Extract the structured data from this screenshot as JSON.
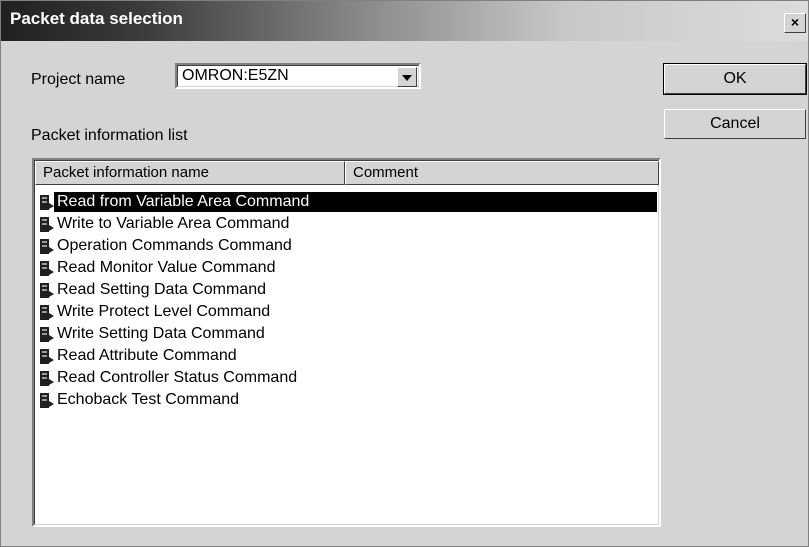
{
  "window": {
    "title": "Packet data selection",
    "close_label": "×"
  },
  "project": {
    "label": "Project name",
    "value": "OMRON:E5ZN"
  },
  "buttons": {
    "ok": "OK",
    "cancel": "Cancel"
  },
  "list": {
    "label": "Packet information list",
    "columns": [
      "Packet information name",
      "Comment"
    ],
    "selected_index": 0,
    "rows": [
      "Read from Variable Area Command",
      "Write to Variable Area Command",
      "Operation Commands Command",
      "Read Monitor Value Command",
      "Read Setting Data Command",
      "Write Protect Level Command",
      "Write Setting Data Command",
      "Read Attribute Command",
      "Read Controller Status Command",
      "Echoback Test Command"
    ]
  }
}
